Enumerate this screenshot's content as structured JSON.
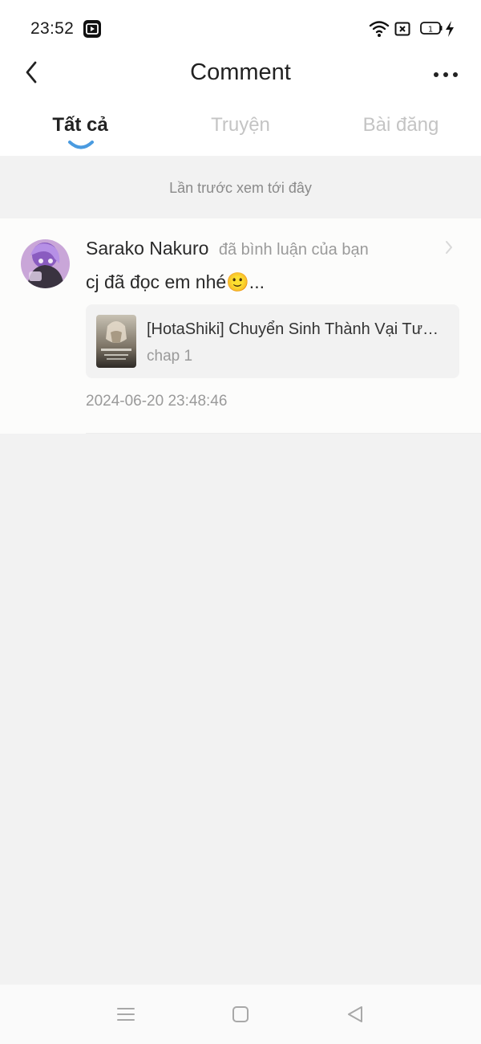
{
  "status_bar": {
    "time": "23:52",
    "app_icon": "video-play-icon",
    "battery_level": "1",
    "icons": [
      "wifi-icon",
      "sim-icon",
      "battery-icon",
      "charging-bolt-icon"
    ]
  },
  "header": {
    "title": "Comment",
    "back_icon": "chevron-left-icon",
    "more_icon": "more-horizontal-icon"
  },
  "tabs": [
    {
      "label": "Tất cả",
      "active": true
    },
    {
      "label": "Truyện",
      "active": false
    },
    {
      "label": "Bài đăng",
      "active": false
    }
  ],
  "last_seen_label": "Lần trước xem tới đây",
  "notifications": [
    {
      "user": "Sarako Nakuro",
      "action": "đã bình luận của bạn",
      "comment": "cj đã đọc em nhé🙂...",
      "reference": {
        "title": "[HotaShiki] Chuyển Sinh Thành Vại Tương...",
        "chapter": "chap 1"
      },
      "timestamp": "2024-06-20 23:48:46"
    }
  ],
  "colors": {
    "accent": "#4a9be0",
    "background": "#f2f2f2",
    "inactive_tab": "#c4c4c4",
    "secondary_text": "#9a9a9a"
  }
}
